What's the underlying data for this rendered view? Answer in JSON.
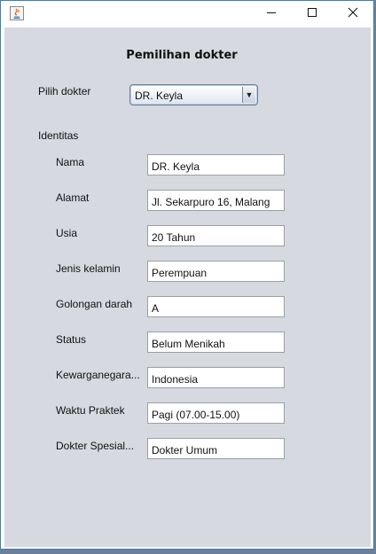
{
  "window": {
    "title": "",
    "controls": {
      "minimize_icon": "minimize-icon",
      "maximize_icon": "maximize-icon",
      "close_icon": "close-icon"
    }
  },
  "form": {
    "heading": "Pemilihan dokter",
    "select_label": "Pilih dokter",
    "select_value": "DR. Keyla",
    "section_label": "Identitas",
    "fields": [
      {
        "label": "Nama",
        "value": "DR. Keyla"
      },
      {
        "label": "Alamat",
        "value": "Jl. Sekarpuro 16, Malang"
      },
      {
        "label": "Usia",
        "value": "20 Tahun"
      },
      {
        "label": "Jenis kelamin",
        "value": "Perempuan"
      },
      {
        "label": "Golongan darah",
        "value": "A"
      },
      {
        "label": "Status",
        "value": "Belum Menikah"
      },
      {
        "label": "Kewarganegara...",
        "value": "Indonesia"
      },
      {
        "label": "Waktu Praktek",
        "value": " Pagi (07.00-15.00)"
      },
      {
        "label": "Dokter Spesial...",
        "value": "Dokter Umum"
      }
    ]
  },
  "colors": {
    "panel_background": "#d6d9df",
    "window_border": "#3c7fb1",
    "desktop": "#6b7f99"
  }
}
